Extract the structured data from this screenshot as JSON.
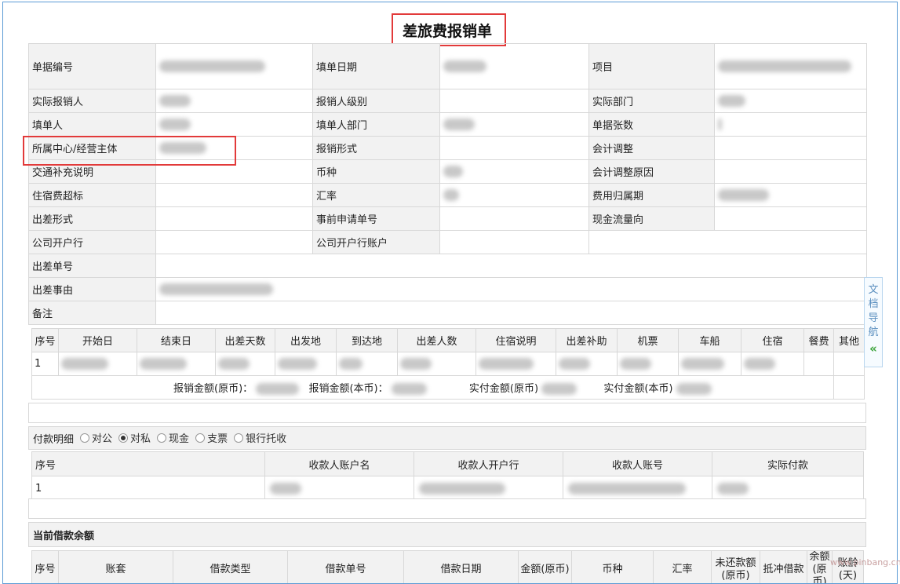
{
  "title": "差旅费报销单",
  "form_rows": [
    [
      {
        "label": "单据编号",
        "blur": 135
      },
      {
        "label": "填单日期",
        "blur": 55
      },
      {
        "label": "项目",
        "blur": 170
      }
    ],
    [
      {
        "label": "实际报销人",
        "blur": 40
      },
      {
        "label": "报销人级别",
        "blur": 0
      },
      {
        "label": "实际部门",
        "blur": 35
      }
    ],
    [
      {
        "label": "填单人",
        "blur": 40
      },
      {
        "label": "填单人部门",
        "blur": 40
      },
      {
        "label": "单据张数",
        "blur": 5
      }
    ],
    [
      {
        "label": "所属中心/经营主体",
        "blur": 60
      },
      {
        "label": "报销形式",
        "blur": 0
      },
      {
        "label": "会计调整",
        "blur": 0
      }
    ],
    [
      {
        "label": "交通补充说明",
        "blur": 0
      },
      {
        "label": "币种",
        "blur": 25
      },
      {
        "label": "会计调整原因",
        "blur": 0
      }
    ],
    [
      {
        "label": "住宿费超标",
        "blur": 0
      },
      {
        "label": "汇率",
        "blur": 20
      },
      {
        "label": "费用归属期",
        "blur": 65
      }
    ],
    [
      {
        "label": "出差形式",
        "blur": 0
      },
      {
        "label": "事前申请单号",
        "blur": 0
      },
      {
        "label": "现金流量向",
        "blur": 0
      }
    ],
    [
      {
        "label": "公司开户行",
        "blur": 0
      },
      {
        "label": "公司开户行账户",
        "blur": 0
      }
    ]
  ],
  "form_single_rows": [
    {
      "label": "出差单号",
      "blur": 0
    },
    {
      "label": "出差事由",
      "blur": 145
    },
    {
      "label": "备注",
      "blur": 0
    }
  ],
  "trip_table": {
    "headers": [
      "序号",
      "开始日",
      "结束日",
      "出差天数",
      "出发地",
      "到达地",
      "出差人数",
      "住宿说明",
      "出差补助",
      "机票",
      "车船",
      "住宿",
      "餐费",
      "其他"
    ],
    "row_no": "1",
    "totals": {
      "label1": "报销金额(原币)：",
      "label2": "报销金额(本币)：",
      "label3": "实付金额(原币)",
      "label4": "实付金额(本币)"
    }
  },
  "payment": {
    "label": "付款明细",
    "options": [
      {
        "text": "对公",
        "checked": false
      },
      {
        "text": "对私",
        "checked": true
      },
      {
        "text": "现金",
        "checked": false
      },
      {
        "text": "支票",
        "checked": false
      },
      {
        "text": "银行托收",
        "checked": false
      }
    ]
  },
  "payee_table": {
    "headers": [
      "序号",
      "收款人账户名",
      "收款人开户行",
      "收款人账号",
      "实际付款"
    ],
    "row_no": "1"
  },
  "loan": {
    "title": "当前借款余额",
    "headers": [
      "序号",
      "账套",
      "借款类型",
      "借款单号",
      "借款日期",
      "金额(原币)",
      "币种",
      "汇率",
      "未还款额\n(原币)",
      "抵冲借款",
      "余额\n(原币)",
      "账龄\n(天)"
    ]
  },
  "docnav": {
    "chars": [
      "文",
      "档",
      "导",
      "航"
    ],
    "chevron": "«"
  },
  "watermark": "www.pinbang.cn"
}
